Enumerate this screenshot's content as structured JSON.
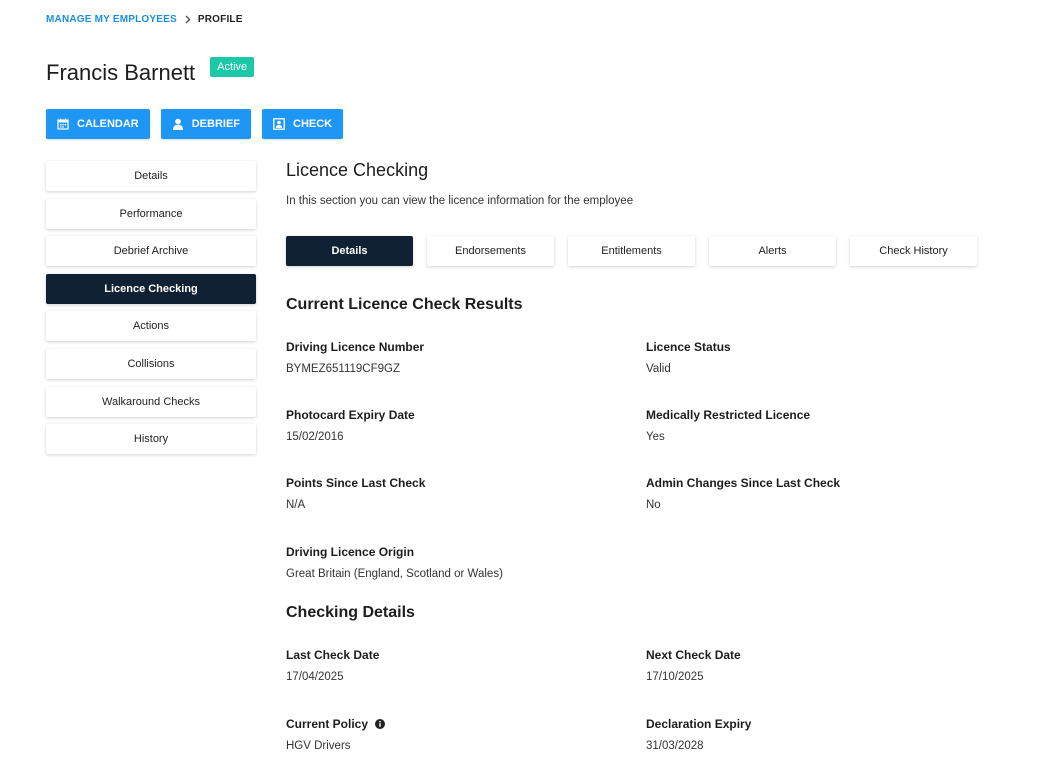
{
  "breadcrumb": {
    "parent": "MANAGE MY EMPLOYEES",
    "current": "PROFILE"
  },
  "employee": {
    "name": "Francis Barnett",
    "status": "Active"
  },
  "actions": {
    "calendar": "CALENDAR",
    "debrief": "DEBRIEF",
    "check": "CHECK"
  },
  "sidebar": {
    "items": [
      {
        "label": "Details"
      },
      {
        "label": "Performance"
      },
      {
        "label": "Debrief Archive"
      },
      {
        "label": "Licence Checking",
        "active": true
      },
      {
        "label": "Actions"
      },
      {
        "label": "Collisions"
      },
      {
        "label": "Walkaround Checks"
      },
      {
        "label": "History"
      }
    ]
  },
  "main": {
    "title": "Licence Checking",
    "description": "In this section you can view the licence information for the employee",
    "tabs": [
      {
        "label": "Details",
        "active": true
      },
      {
        "label": "Endorsements"
      },
      {
        "label": "Entitlements"
      },
      {
        "label": "Alerts"
      },
      {
        "label": "Check History"
      }
    ],
    "current_results": {
      "title": "Current Licence Check Results",
      "driving_licence_number": {
        "label": "Driving Licence Number",
        "value": "BYMEZ651119CF9GZ"
      },
      "licence_status": {
        "label": "Licence Status",
        "value": "Valid"
      },
      "photocard_expiry": {
        "label": "Photocard Expiry Date",
        "value": "15/02/2016"
      },
      "medically_restricted": {
        "label": "Medically Restricted Licence",
        "value": "Yes"
      },
      "points_since_last": {
        "label": "Points Since Last Check",
        "value": "N/A"
      },
      "admin_changes": {
        "label": "Admin Changes Since Last Check",
        "value": "No"
      },
      "licence_origin": {
        "label": "Driving Licence Origin",
        "value": "Great Britain (England, Scotland or Wales)"
      }
    },
    "checking_details": {
      "title": "Checking Details",
      "last_check": {
        "label": "Last Check Date",
        "value": "17/04/2025"
      },
      "next_check": {
        "label": "Next Check Date",
        "value": "17/10/2025"
      },
      "current_policy": {
        "label": "Current Policy",
        "value": "HGV Drivers"
      },
      "declaration_expiry": {
        "label": "Declaration Expiry",
        "value": "31/03/2028"
      }
    }
  },
  "colors": {
    "primary_button": "#1e96f3",
    "active_nav": "#0f2132",
    "status_badge": "#1cc9a7",
    "link": "#1a8fe0"
  },
  "icons": {
    "breadcrumb_separator": "chevron-right-icon",
    "calendar": "calendar-icon",
    "debrief": "user-icon",
    "check": "id-card-icon",
    "policy_info": "info-icon"
  }
}
